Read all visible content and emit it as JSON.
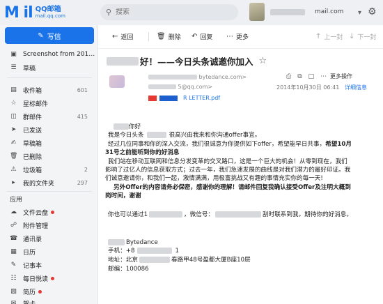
{
  "header": {
    "logo_text": "M il",
    "logo_brand": "QQ邮箱",
    "logo_domain": "mail.qq.com",
    "search_placeholder": "搜索",
    "account_suffix": "mail.com",
    "menu_chevron": "▾",
    "settings_icon": "gear-icon"
  },
  "sidebar": {
    "compose_label": "写信",
    "items": [
      {
        "label": "Screenshot from 201…",
        "icon": "image-icon"
      },
      {
        "label": "草稿",
        "icon": "draft-icon"
      },
      {
        "label": "收件箱",
        "count": "601",
        "icon": "inbox-icon"
      },
      {
        "label": "星标邮件",
        "icon": "star-icon"
      },
      {
        "label": "群邮件",
        "count": "415",
        "icon": "group-icon"
      },
      {
        "label": "已发送",
        "icon": "send-icon"
      },
      {
        "label": "草稿箱",
        "icon": "drafts-icon"
      },
      {
        "label": "已删除",
        "icon": "trash-icon"
      },
      {
        "label": "垃圾箱",
        "count": "2",
        "icon": "spam-icon"
      },
      {
        "label": "我的文件夹",
        "count": "297",
        "icon": "folder-icon"
      }
    ],
    "apps_title": "应用",
    "apps": [
      {
        "label": "文件云盘",
        "dot": true,
        "icon": "cloud-icon"
      },
      {
        "label": "附件管理",
        "icon": "attachment-icon"
      },
      {
        "label": "通讯录",
        "icon": "contacts-icon"
      },
      {
        "label": "日历",
        "icon": "calendar-icon"
      },
      {
        "label": "记事本",
        "icon": "notepad-icon"
      },
      {
        "label": "每日悦读",
        "dot": true,
        "icon": "reading-icon"
      },
      {
        "label": "简历",
        "dot": true,
        "icon": "resume-icon"
      },
      {
        "label": "贺卡",
        "icon": "card-icon"
      }
    ]
  },
  "toolbar": {
    "back": "返回",
    "delete": "删除",
    "reply": "回复",
    "more": "更多",
    "prev": "上一封",
    "next": "下一封"
  },
  "email": {
    "subject_suffix": "好！——今日头条诚邀你加入",
    "sender_email_tail": "bytedance.com>",
    "recipient_tail": "5@qq.com>",
    "date": "2014年10月30日 06:41",
    "details": "详细信息",
    "more_actions": "更多操作",
    "attachment": "R LETTER.pdf",
    "greeting_suffix": "你好",
    "line1_a": "我是今日头条",
    "line1_b": "很高兴由我来和你沟通offer事宜。",
    "line2": "经过几位同事和你的深入交流，我们很诚意为你提供如下offer，希望能早日共事，",
    "line2_bold": "希望10月",
    "line3_bold": "31号之前能听到你的好消息",
    "line4": "我们站在移动互联网和信息分发变革的交叉路口，这是一个巨大的机会！从零到现在，我们",
    "line5": "影响了过亿人的信息获取方式；过去一年，我们急速发展的曲线是对我们潜力的最好印证。我",
    "line6": "们诚意邀请你，和我们一起，激情满满，用极富挑战又有趣的事情充实你的每一天!",
    "line7_bold": "另外Offer的内容请务必保密，感谢你的理解！请邮件回复我确认接受Offer及注明大概到",
    "line8_bold": "岗时间，谢谢",
    "line9_a": "你也可以通过1",
    "line9_b": "，微信号：",
    "line9_c": "刮时联系到我，期待你的好消息。",
    "sig_name_tail": "Bytedance",
    "sig_phone_label": "手机：+8",
    "sig_phone_tail": "1",
    "sig_address": "地址：北京",
    "sig_address_tail": "春路甲48号盈都大厦B座10层",
    "sig_postcode": "邮编：100086"
  }
}
